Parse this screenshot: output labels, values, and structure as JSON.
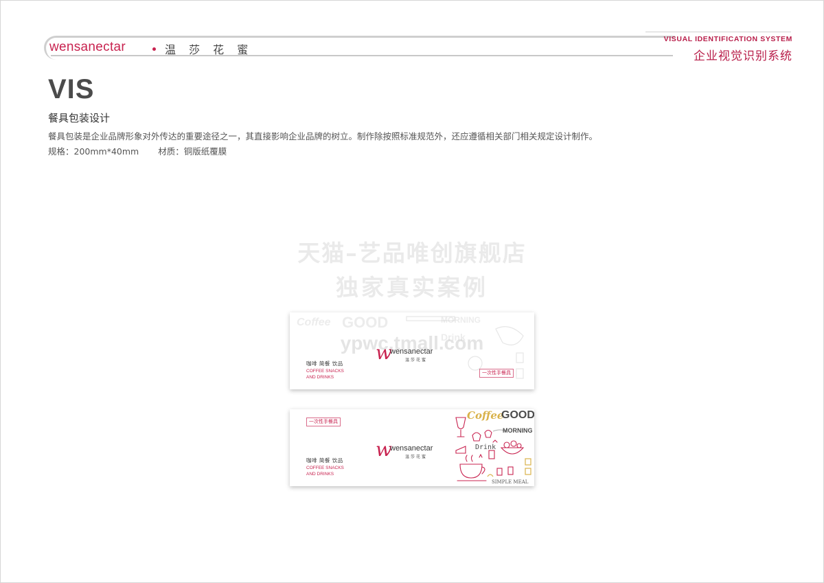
{
  "header": {
    "brand_en": "wensanectar",
    "brand_cn": "温 莎 花 蜜",
    "system_en": "VISUAL IDENTIFICATION SYSTEM",
    "system_cn": "企业视觉识别系统"
  },
  "page": {
    "title": "VIS",
    "section": "餐具包装设计",
    "description": "餐具包装是企业品牌形象对外传达的重要途径之一，其直接影响企业品牌的树立。制作除按照标准规范外，还应遵循相关部门相关规定设计制作。",
    "spec_size": "规格：200mm*40mm",
    "spec_material": "材质：铜版纸覆膜"
  },
  "watermark": {
    "line1": "天猫–艺品唯创旗舰店",
    "line2": "独家真实案例",
    "url": "ypwc.tmall.com"
  },
  "card": {
    "logo_text": "wensanectar",
    "logo_cn": "温莎花蜜",
    "cn_line": "咖啡  简餐  饮品",
    "en_line1": "COFFEE SNACKS",
    "en_line2": "AND DRINKS",
    "badge": "一次性手餐具"
  },
  "illustration": {
    "coffee": "Coffee",
    "good": "GOOD",
    "morning": "MORNING",
    "drink": "Drink",
    "simple_meal": "SIMPLE MEAL"
  },
  "colors": {
    "brand_red": "#c8224f",
    "gold": "#d9b24a",
    "grey": "#4b4b4b"
  }
}
